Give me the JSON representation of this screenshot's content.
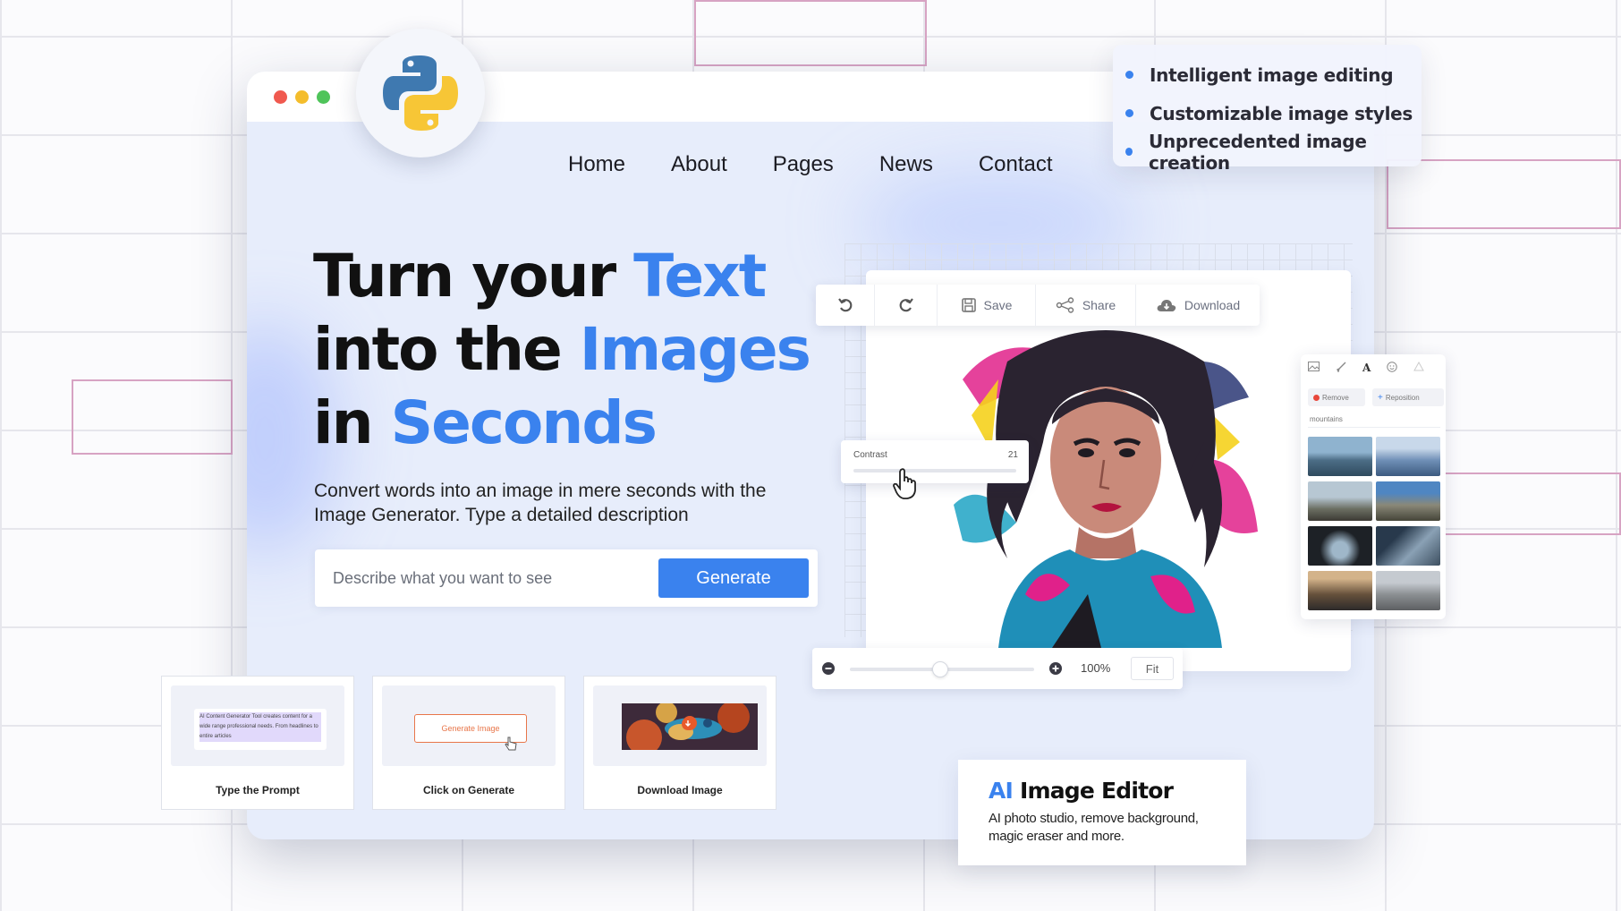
{
  "nav": {
    "items": [
      "Home",
      "About",
      "Pages",
      "News",
      "Contact"
    ]
  },
  "hero": {
    "line1_a": "Turn your ",
    "line1_b": "Text",
    "line2_a": "into the ",
    "line2_b": "Images",
    "line3_a": "in ",
    "line3_b": "Seconds",
    "subtext": "Convert words into an image in mere seconds with the Image Generator. Type a detailed description"
  },
  "search": {
    "placeholder": "Describe what you want to see",
    "button_label": "Generate"
  },
  "steps": [
    {
      "label": "Type the Prompt",
      "thumb_text": "AI Content Generator Tool creates content for a wide range professional needs. From headlines to entire articles"
    },
    {
      "label": "Click on Generate",
      "thumb_button": "Generate Image"
    },
    {
      "label": "Download Image"
    }
  ],
  "features": [
    "Intelligent image editing",
    "Customizable image styles",
    "Unprecedented image creation"
  ],
  "editor": {
    "toolbar": {
      "undo_icon": "undo-icon",
      "redo_icon": "redo-icon",
      "save_label": "Save",
      "share_label": "Share",
      "download_label": "Download"
    },
    "contrast": {
      "label": "Contrast",
      "value": "21"
    },
    "zoom": {
      "percent": "100%",
      "fit_label": "Fit",
      "level": 0.5
    },
    "side_panel": {
      "remove_label": "Remove",
      "reposition_label": "Reposition",
      "search_value": "mountains"
    }
  },
  "ai_card": {
    "title_a": "AI",
    "title_b": " Image Editor",
    "desc": "AI photo studio, remove background, magic eraser and more."
  },
  "colors": {
    "accent": "#3a82ee",
    "window_bg": "#e7edfb",
    "dot_red": "#f0594f",
    "dot_yellow": "#f4bd2c",
    "dot_green": "#4fc45a"
  }
}
